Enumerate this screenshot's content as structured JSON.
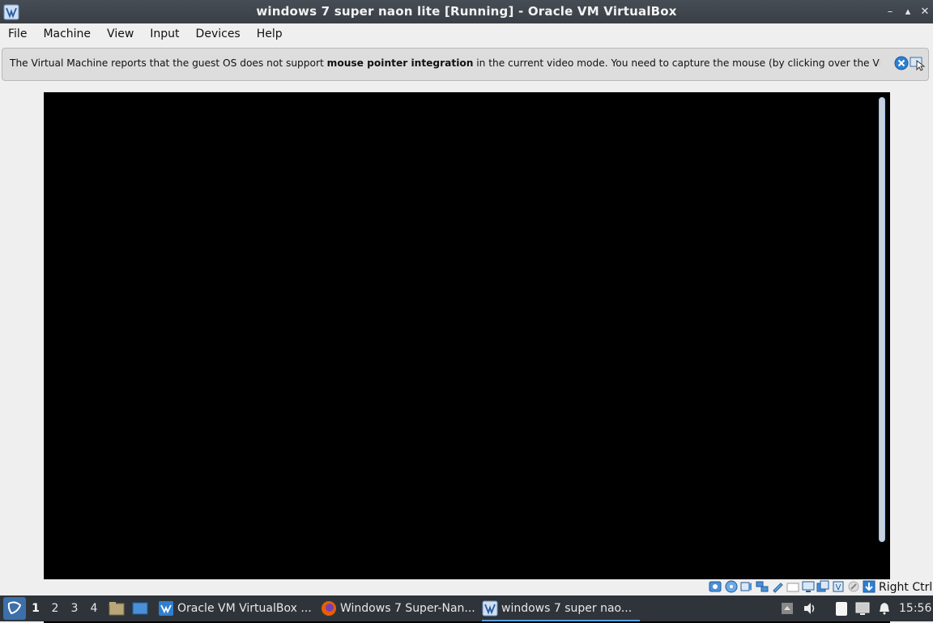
{
  "window": {
    "title": "windows 7 super naon lite [Running] - Oracle VM VirtualBox",
    "minimize": "–",
    "maximize": "▴",
    "close": "✕"
  },
  "menu": {
    "items": [
      "File",
      "Machine",
      "View",
      "Input",
      "Devices",
      "Help"
    ]
  },
  "notice": {
    "text_before": "The Virtual Machine reports that the guest OS does not support ",
    "text_bold": "mouse pointer integration",
    "text_after": " in the current video mode. You need to capture the mouse (by clicking over the VM display"
  },
  "statusbar": {
    "icons": [
      "hard-disk-icon",
      "optical-disk-icon",
      "audio-icon",
      "network-icon",
      "usb-icon",
      "shared-folders-icon",
      "display-icon",
      "video-capture-icon",
      "cpu-icon",
      "mouse-integration-icon",
      "keyboard-capture-icon"
    ],
    "host_key": "Right Ctrl"
  },
  "taskbar": {
    "desktops": [
      "1",
      "2",
      "3",
      "4"
    ],
    "tasks": [
      {
        "label": "Oracle VM VirtualBox ...",
        "icon": "virtualbox-icon"
      },
      {
        "label": "Windows 7 Super-Nan...",
        "icon": "firefox-icon"
      },
      {
        "label": "windows 7 super nao...",
        "icon": "vm-window-icon"
      }
    ],
    "clock": "15:56"
  },
  "colors": {
    "titlebar": "#3a3f46",
    "taskbar": "#2f343a",
    "vm_screen": "#000000",
    "accent": "#5a9fe0"
  }
}
